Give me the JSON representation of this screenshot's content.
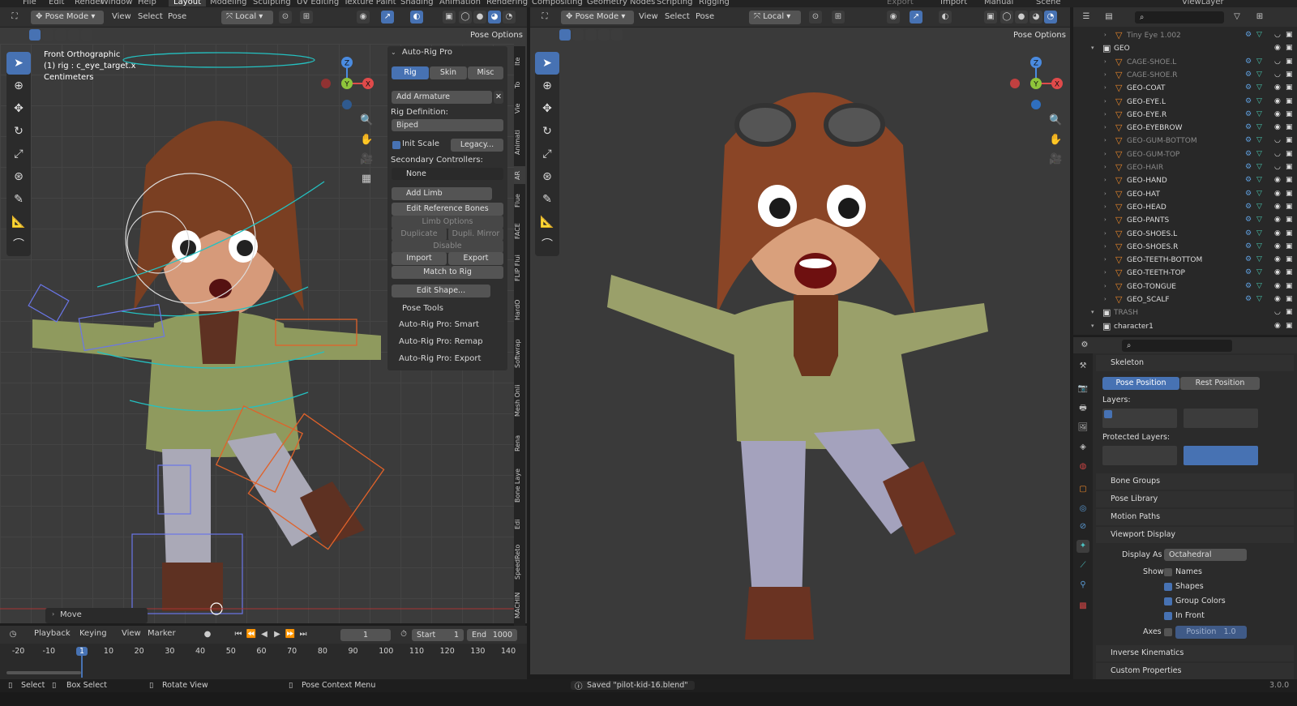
{
  "topbar": {
    "menus": [
      "File",
      "Edit",
      "Render",
      "Window",
      "Help"
    ],
    "workspaces": [
      "Layout",
      "Modeling",
      "Sculpting",
      "UV Editing",
      "Texture Paint",
      "Shading",
      "Animation",
      "Rendering",
      "Compositing",
      "Geometry Nodes",
      "Scripting",
      "Rigging"
    ],
    "right": [
      "Export",
      "Import",
      "Manual",
      "Scene",
      "ViewLayer"
    ]
  },
  "left_viewport": {
    "mode": "Pose Mode",
    "menus": [
      "View",
      "Select",
      "Pose"
    ],
    "transform": "Local",
    "pose_options": "Pose Options",
    "info_line1": "Front Orthographic",
    "info_line2": "(1) rig : c_eye_target.x",
    "info_line3": "Centimeters",
    "operator_panel": "Move",
    "gizmo": {
      "x": "X",
      "y": "Y",
      "z": "Z"
    }
  },
  "npanel": {
    "title": "Auto-Rig Pro",
    "tabs": [
      "Rig",
      "Skin",
      "Misc"
    ],
    "add_armature": "Add Armature",
    "rig_definition_label": "Rig Definition:",
    "rig_definition": "Biped",
    "init_scale": "Init Scale",
    "legacy": "Legacy...",
    "secondary_label": "Secondary Controllers:",
    "secondary": "None",
    "add_limb": "Add Limb",
    "edit_ref_bones": "Edit Reference Bones",
    "limb_options": "Limb Options",
    "duplicate": "Duplicate",
    "dupli_mirror": "Dupli. Mirror",
    "disable": "Disable",
    "import": "Import",
    "export": "Export",
    "match_to_rig": "Match to Rig",
    "edit_shape": "Edit Shape...",
    "pose_tools": "Pose Tools",
    "smart": "Auto-Rig Pro: Smart",
    "remap": "Auto-Rig Pro: Remap",
    "export_panel": "Auto-Rig Pro: Export"
  },
  "vertical_tabs": [
    "Ite",
    "To",
    "Vie",
    "Animati",
    "AR",
    "Flue",
    "FACE",
    "FLIP Flui",
    "HardO",
    "Softwrap",
    "Mesh Onli",
    "Rena",
    "Bone Laye",
    "Edi",
    "SpeedReto",
    "MACHIN"
  ],
  "right_viewport": {
    "mode": "Pose Mode",
    "menus": [
      "View",
      "Select",
      "Pose"
    ],
    "transform": "Local",
    "pose_options": "Pose Options"
  },
  "outliner": {
    "rows": [
      {
        "name": "Tiny Eye 1.002",
        "dim": true,
        "indent": 1
      },
      {
        "name": "GEO",
        "dim": false,
        "indent": 0,
        "collection": true
      },
      {
        "name": "CAGE-SHOE.L",
        "dim": true,
        "indent": 1
      },
      {
        "name": "CAGE-SHOE.R",
        "dim": true,
        "indent": 1
      },
      {
        "name": "GEO-COAT",
        "dim": false,
        "indent": 1
      },
      {
        "name": "GEO-EYE.L",
        "dim": false,
        "indent": 1
      },
      {
        "name": "GEO-EYE.R",
        "dim": false,
        "indent": 1
      },
      {
        "name": "GEO-EYEBROW",
        "dim": false,
        "indent": 1
      },
      {
        "name": "GEO-GUM-BOTTOM",
        "dim": true,
        "indent": 1
      },
      {
        "name": "GEO-GUM-TOP",
        "dim": true,
        "indent": 1
      },
      {
        "name": "GEO-HAIR",
        "dim": true,
        "indent": 1
      },
      {
        "name": "GEO-HAND",
        "dim": false,
        "indent": 1
      },
      {
        "name": "GEO-HAT",
        "dim": false,
        "indent": 1
      },
      {
        "name": "GEO-HEAD",
        "dim": false,
        "indent": 1
      },
      {
        "name": "GEO-PANTS",
        "dim": false,
        "indent": 1
      },
      {
        "name": "GEO-SHOES.L",
        "dim": false,
        "indent": 1
      },
      {
        "name": "GEO-SHOES.R",
        "dim": false,
        "indent": 1
      },
      {
        "name": "GEO-TEETH-BOTTOM",
        "dim": false,
        "indent": 1
      },
      {
        "name": "GEO-TEETH-TOP",
        "dim": false,
        "indent": 1
      },
      {
        "name": "GEO-TONGUE",
        "dim": false,
        "indent": 1
      },
      {
        "name": "GEO_SCALF",
        "dim": false,
        "indent": 1
      },
      {
        "name": "TRASH",
        "dim": true,
        "indent": 0,
        "collection": true
      },
      {
        "name": "character1",
        "dim": false,
        "indent": 0,
        "collection": true
      }
    ]
  },
  "properties": {
    "skeleton": "Skeleton",
    "pose_position": "Pose Position",
    "rest_position": "Rest Position",
    "layers": "Layers:",
    "protected_layers": "Protected Layers:",
    "bone_groups": "Bone Groups",
    "pose_library": "Pose Library",
    "motion_paths": "Motion Paths",
    "viewport_display": "Viewport Display",
    "display_as_label": "Display As",
    "display_as": "Octahedral",
    "show_label": "Show",
    "names": "Names",
    "shapes": "Shapes",
    "group_colors": "Group Colors",
    "in_front": "In Front",
    "axes_label": "Axes",
    "position": "Position",
    "position_value": "1.0",
    "inverse_kinematics": "Inverse Kinematics",
    "custom_properties": "Custom Properties"
  },
  "timeline": {
    "playback": "Playback",
    "keying": "Keying",
    "view": "View",
    "marker": "Marker",
    "current_frame": "1",
    "start_label": "Start",
    "start": "1",
    "end_label": "End",
    "end": "1000",
    "ticks": [
      "-20",
      "-10",
      "1",
      "10",
      "20",
      "30",
      "40",
      "50",
      "60",
      "70",
      "80",
      "90",
      "100",
      "110",
      "120",
      "130",
      "140"
    ]
  },
  "statusbar": {
    "select": "Select",
    "box_select": "Box Select",
    "rotate_view": "Rotate View",
    "pose_context": "Pose Context Menu",
    "saved": "Saved \"pilot-kid-16.blend\"",
    "version": "3.0.0"
  },
  "colors": {
    "accent": "#4772b3",
    "rig_teal": "#24c1c1",
    "rig_orange": "#e0622a",
    "rig_blue": "#6a76e8"
  }
}
